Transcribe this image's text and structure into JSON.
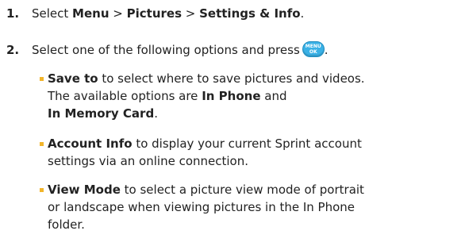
{
  "steps": [
    {
      "number": "1.",
      "parts": {
        "t1": "Select ",
        "menu": "Menu",
        "sep1": " > ",
        "pictures": "Pictures",
        "sep2": " > ",
        "settings": "Settings & Info",
        "end": "."
      }
    },
    {
      "number": "2.",
      "text": "Select one of the following options and press",
      "key": {
        "top": "MENU",
        "bottom": "OK",
        "icon": "menu-ok-key-icon",
        "color": "#3ab1e6"
      },
      "end": "."
    }
  ],
  "options": [
    {
      "lines": [
        {
          "bold": "Save to",
          "text": " to select where to save pictures and videos."
        },
        {
          "text": "The available options are ",
          "bold": "In Phone",
          "text2": " and"
        },
        {
          "bold": "In Memory Card",
          "text": "."
        }
      ]
    },
    {
      "lines": [
        {
          "bold": "Account Info",
          "text": " to display your current Sprint account"
        },
        {
          "text": "settings via an online connection."
        }
      ]
    },
    {
      "lines": [
        {
          "bold": "View Mode",
          "text": " to select a picture view mode of portrait"
        },
        {
          "text": "or landscape when viewing pictures in the In Phone"
        },
        {
          "text": "folder."
        }
      ]
    }
  ],
  "colors": {
    "bullet": "#f2b52b",
    "text": "#222222"
  }
}
